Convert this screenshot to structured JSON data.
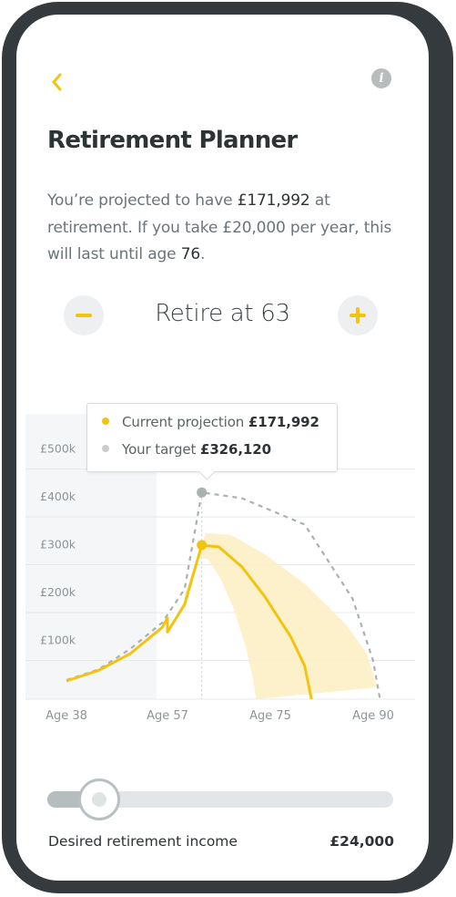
{
  "header": {
    "back_icon": "chevron-left-icon",
    "info_icon": "info-icon",
    "info_glyph": "i",
    "title": "Retirement Planner"
  },
  "summary": {
    "part1": "You’re projected to have ",
    "amount": "£171,992",
    "part2": " at retirement. If you take £20,000 per year, this will last until age ",
    "age": "76",
    "part3": "."
  },
  "retire_control": {
    "minus_icon": "minus-icon",
    "plus_icon": "plus-icon",
    "label": "Retire at 63",
    "retire_age": 63
  },
  "tooltip": {
    "current_label": "Current projection",
    "current_value": "£171,992",
    "target_label": "Your target",
    "target_value": "£326,120"
  },
  "colors": {
    "accent": "#f2c40f",
    "band": "#fcefc2",
    "target": "#a9b1b3",
    "text_dark": "#2e3336"
  },
  "chart_data": {
    "type": "line",
    "ylabels": [
      "£500k",
      "£400k",
      "£300k",
      "£200k",
      "£100k"
    ],
    "xlabels": [
      "Age 38",
      "Age 57",
      "Age 75",
      "Age 90"
    ],
    "ylim": [
      0,
      500000
    ],
    "retire_age": 63,
    "series": [
      {
        "name": "Current projection",
        "points": [
          [
            38,
            38000
          ],
          [
            44,
            60000
          ],
          [
            50,
            95000
          ],
          [
            56,
            150000
          ],
          [
            57,
            170000
          ],
          [
            57,
            140000
          ],
          [
            60,
            198000
          ],
          [
            63,
            322000
          ],
          [
            66,
            318000
          ],
          [
            70,
            277000
          ],
          [
            74,
            215000
          ],
          [
            78,
            130000
          ],
          [
            80,
            70000
          ],
          [
            81,
            0
          ]
        ]
      },
      {
        "name": "Your target",
        "points": [
          [
            38,
            40000
          ],
          [
            44,
            62000
          ],
          [
            50,
            105000
          ],
          [
            56,
            160000
          ],
          [
            60,
            230000
          ],
          [
            63,
            432000
          ],
          [
            70,
            420000
          ],
          [
            80,
            365000
          ],
          [
            87,
            210000
          ],
          [
            90,
            80000
          ],
          [
            91,
            0
          ]
        ]
      }
    ]
  },
  "income": {
    "label": "Desired retirement income",
    "value": "£24,000",
    "slider_fraction": 0.14
  }
}
